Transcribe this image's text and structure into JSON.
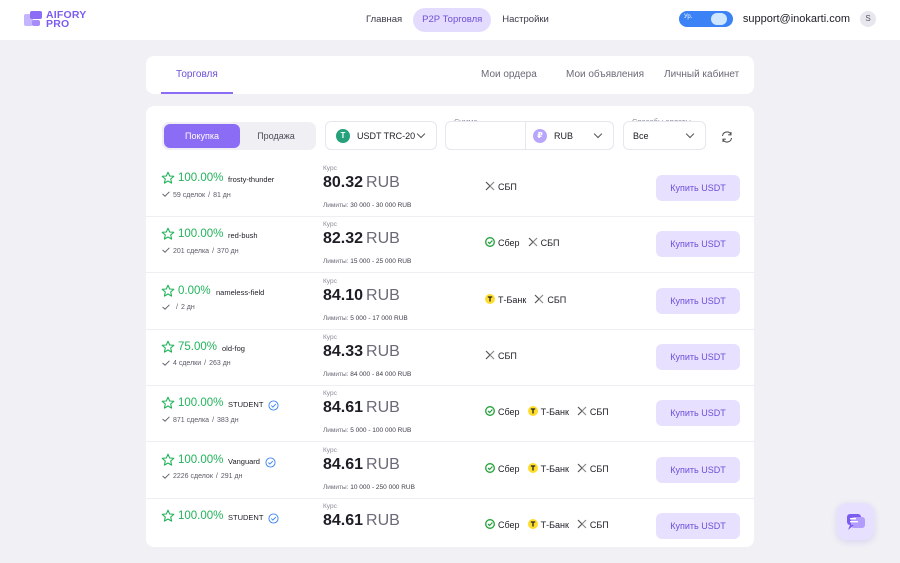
{
  "header": {
    "logo_line1": "AIFORY",
    "logo_line2": "PRO",
    "nav": [
      "Главная",
      "P2P Торговля",
      "Настройки"
    ],
    "toggle_label": "Ур.",
    "email": "support@inokarti.com",
    "avatar_letter": "S"
  },
  "tabs": [
    "Торговля",
    "Мои ордера",
    "Мои объявления",
    "Личный кабинет"
  ],
  "filters": {
    "buy_label": "Покупка",
    "sell_label": "Продажа",
    "coin": "USDT TRC-20",
    "amount_label": "Сумма",
    "currency": "RUB",
    "pay_label": "Способы оплаты",
    "pay_value": "Все"
  },
  "labels": {
    "rate": "Курс",
    "limits": "Лимиты:",
    "currency": "RUB",
    "buy_button": "Купить USDT"
  },
  "colors": {
    "accent": "#8b6cf5",
    "success": "#22b35c",
    "sber": "#21a038",
    "tbank": "#ffdd2d"
  },
  "offers": [
    {
      "pct": "100.00%",
      "name": "frosty-thunder",
      "verified": false,
      "deals": "59 сделок",
      "days": "81 дн",
      "price": "80.32",
      "limits": "30 000 - 30 000 RUB",
      "methods": [
        "СБП"
      ]
    },
    {
      "pct": "100.00%",
      "name": "red-bush",
      "verified": false,
      "deals": "201 сделка",
      "days": "370 дн",
      "price": "82.32",
      "limits": "15 000 - 25 000 RUB",
      "methods": [
        "Сбер",
        "СБП"
      ]
    },
    {
      "pct": "0.00%",
      "name": "nameless-field",
      "verified": false,
      "deals": "",
      "days": "2 дн",
      "price": "84.10",
      "limits": "5 000 - 17 000 RUB",
      "methods": [
        "Т-Банк",
        "СБП"
      ]
    },
    {
      "pct": "75.00%",
      "name": "old-fog",
      "verified": false,
      "deals": "4 сделки",
      "days": "263 дн",
      "price": "84.33",
      "limits": "84 000 - 84 000 RUB",
      "methods": [
        "СБП"
      ]
    },
    {
      "pct": "100.00%",
      "name": "STUDENT",
      "verified": true,
      "deals": "871 сделка",
      "days": "383 дн",
      "price": "84.61",
      "limits": "5 000 - 100 000 RUB",
      "methods": [
        "Сбер",
        "Т-Банк",
        "СБП"
      ]
    },
    {
      "pct": "100.00%",
      "name": "Vanguard",
      "verified": true,
      "deals": "2226 сделок",
      "days": "291 дн",
      "price": "84.61",
      "limits": "10 000 - 250 000 RUB",
      "methods": [
        "Сбер",
        "Т-Банк",
        "СБП"
      ]
    },
    {
      "pct": "100.00%",
      "name": "STUDENT",
      "verified": true,
      "deals": "",
      "days": "",
      "price": "84.61",
      "limits": "",
      "methods": [
        "Сбер",
        "Т-Банк",
        "СБП"
      ]
    }
  ]
}
